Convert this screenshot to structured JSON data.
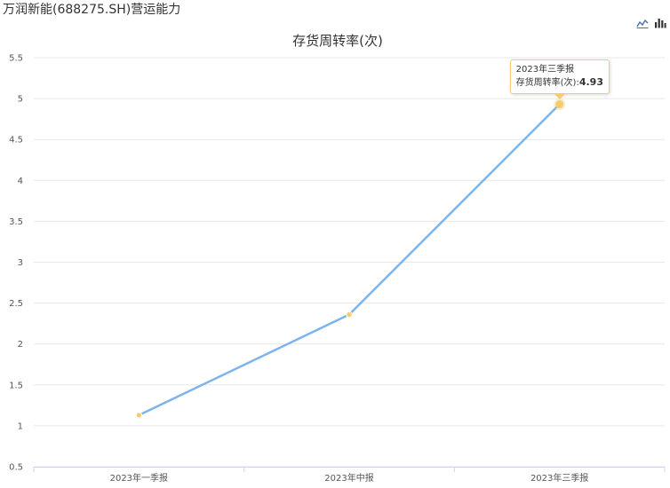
{
  "page": {
    "title": "万润新能(688275.SH)营运能力"
  },
  "toolbar": {
    "line_icon": "line-chart-icon",
    "bar_icon": "bar-chart-icon"
  },
  "colors": {
    "series": "#7cb5ec",
    "point": "#f7cb6f",
    "grid": "#e8e8e8",
    "axis": "#ccd6eb"
  },
  "chart_data": {
    "type": "line",
    "title": "存货周转率(次)",
    "categories": [
      "2023年一季报",
      "2023年中报",
      "2023年三季报"
    ],
    "series": [
      {
        "values": [
          1.13,
          2.36,
          4.93
        ]
      }
    ],
    "ylim": [
      0.5,
      5.5
    ],
    "yticks": [
      "0.5",
      "1",
      "1.5",
      "2",
      "2.5",
      "3",
      "3.5",
      "4",
      "4.5",
      "5",
      "5.5"
    ],
    "grid": true,
    "legend": "none",
    "tooltip": {
      "category": "2023年三季报",
      "label": "存货周转率(次):",
      "value": "4.93",
      "point_index": 2
    }
  }
}
